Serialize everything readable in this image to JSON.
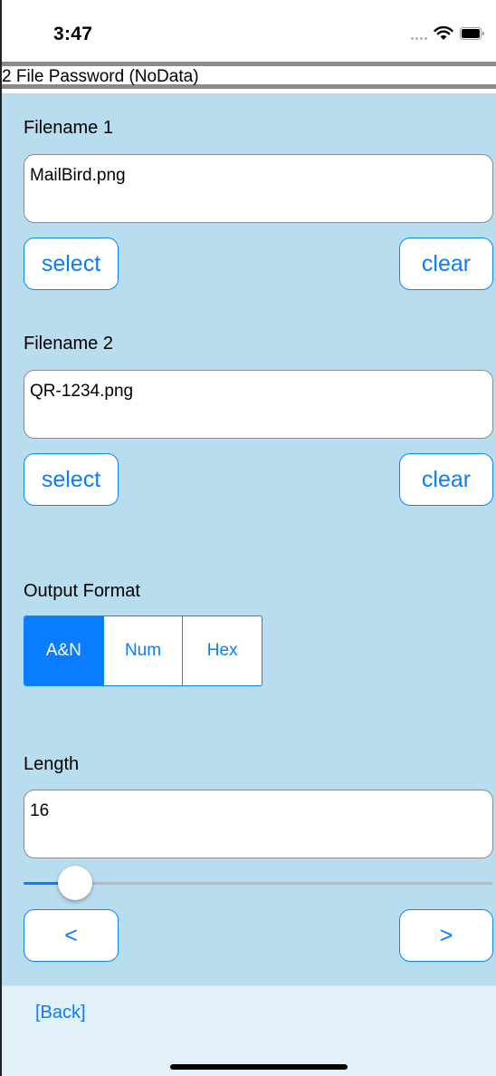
{
  "status_bar": {
    "time": "3:47",
    "icons": [
      "signal-dots-icon",
      "wifi-icon",
      "battery-icon"
    ]
  },
  "title": "2 File Password (NoData)",
  "file1": {
    "label": "Filename 1",
    "value": "MailBird.png",
    "select_label": "select",
    "clear_label": "clear"
  },
  "file2": {
    "label": "Filename 2",
    "value": "QR-1234.png",
    "select_label": "select",
    "clear_label": "clear"
  },
  "output_format": {
    "label": "Output Format",
    "options": [
      "A&N",
      "Num",
      "Hex"
    ],
    "selected": "A&N"
  },
  "length": {
    "label": "Length",
    "value": "16",
    "slider_fraction": 0.08,
    "prev_label": "<",
    "next_label": ">"
  },
  "footer": {
    "back_label": "[Back]"
  },
  "colors": {
    "accent": "#0a7cff",
    "content_background": "#b8ddee",
    "footer_background": "#e3f2f9"
  }
}
